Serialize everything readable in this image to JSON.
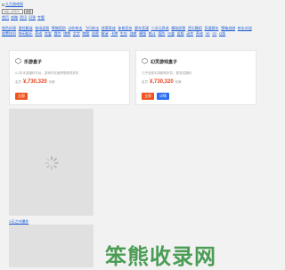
{
  "header": {
    "logo_alt": "九月游戏网",
    "search_placeholder": "请输入搜索词",
    "search_button": "搜索"
  },
  "top_nav": [
    "首页",
    "攻略",
    "资讯",
    "问答",
    "专题"
  ],
  "categories": [
    "角色扮演",
    "冒险解谜",
    "休闲益智",
    "策略塔防",
    "动作射击",
    "飞行射击",
    "经营养成",
    "体育竞技",
    "赛车竞速",
    "二次元养成",
    "模拟经营",
    "音乐舞蹈",
    "竞速赛车",
    "策略战棋",
    "射击对战",
    "放置挂机",
    "休闲娱乐",
    "养成",
    "恋爱",
    "冒险",
    "棋牌",
    "文字",
    "跑酷",
    "益智",
    "解谜",
    "卡牌",
    "生存",
    "战棋",
    "横版",
    "格斗",
    "塔防",
    "沙盒",
    "竖版",
    "动作",
    "养成",
    "3D",
    "2D",
    "Q版"
  ],
  "cards": [
    {
      "icon": "⬡",
      "name": "乐游盒子",
      "desc": "0.1折手游福利平台，游戏内充值享受超低折扣",
      "price_label": "会员",
      "price": "¥,730,320",
      "price_unit": "玩家",
      "buttons": [
        "立即"
      ]
    },
    {
      "icon": "⬡",
      "name": "幻灵游戏盒子",
      "desc": "几乎全部手游都有折扣，登录送福利",
      "price_label": "会员",
      "price": "¥,730,320",
      "price_unit": "玩家",
      "buttons": [
        "立即",
        "详情"
      ]
    }
  ],
  "panel_link": "2天之内爆炸",
  "watermark": "笨熊收录网"
}
